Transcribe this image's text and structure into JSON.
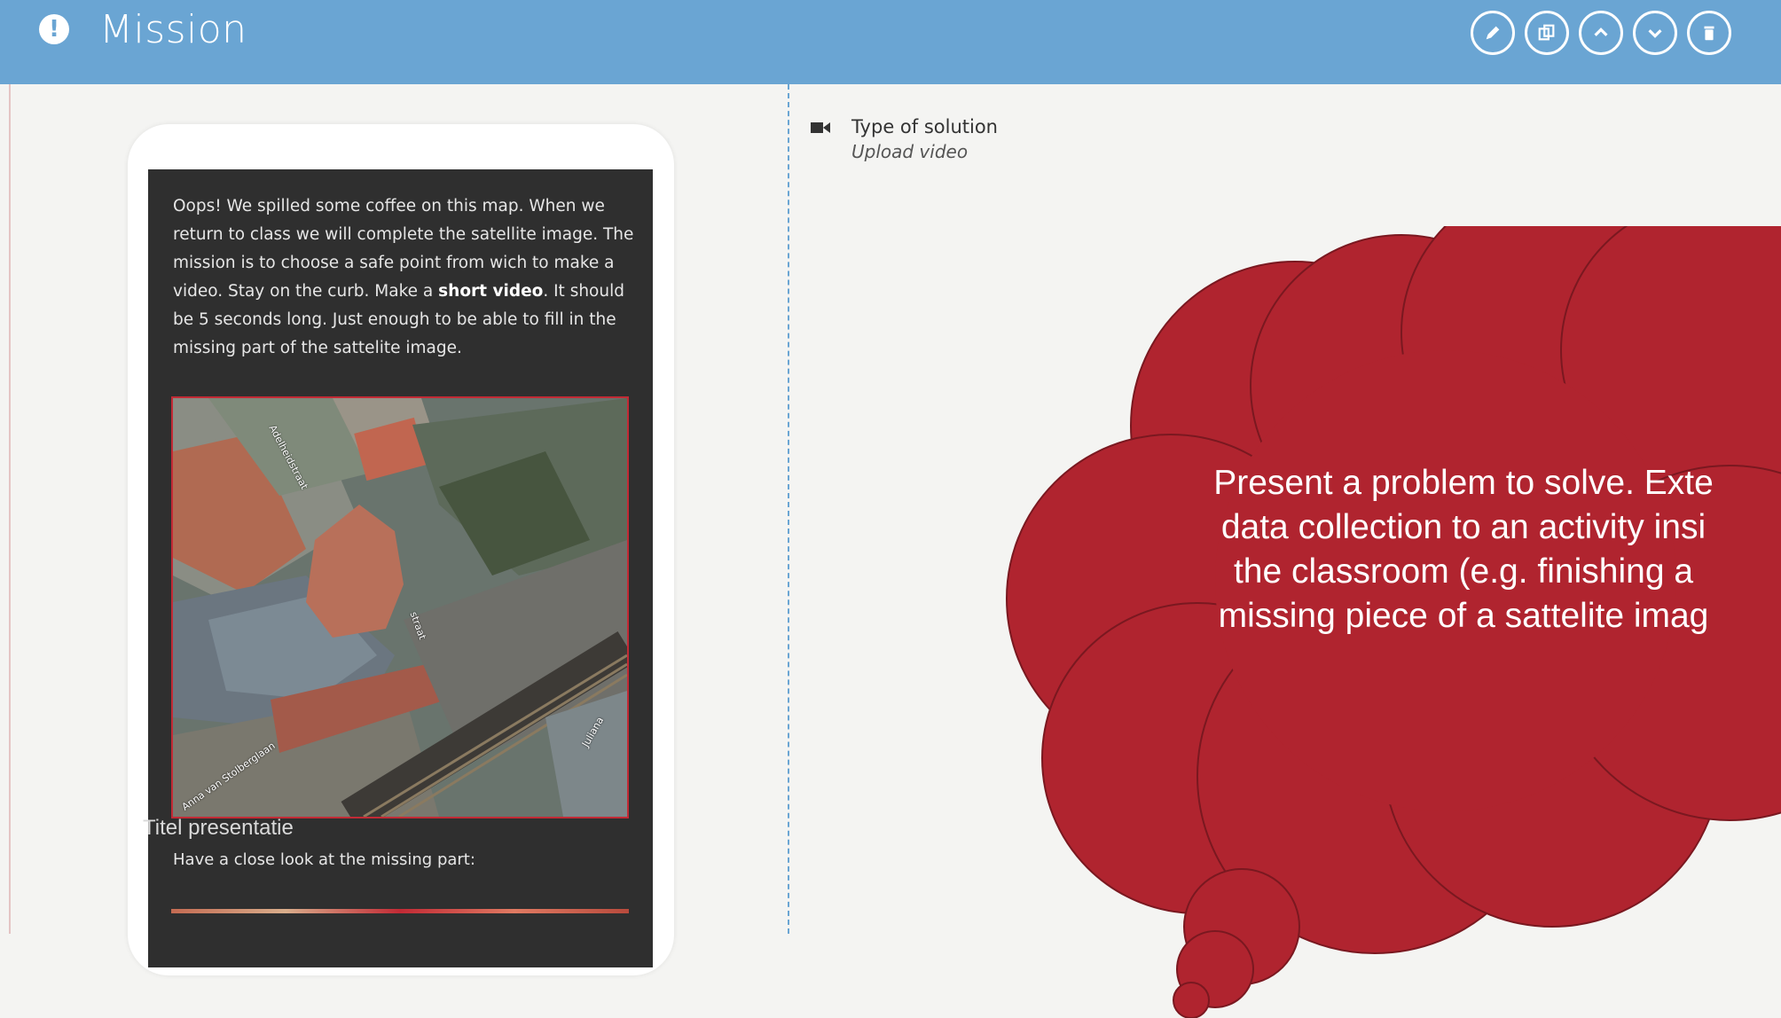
{
  "header": {
    "title": "Mission",
    "alert_icon": "!",
    "actions": [
      {
        "name": "edit-button",
        "icon": "pencil-icon"
      },
      {
        "name": "duplicate-button",
        "icon": "copy-icon"
      },
      {
        "name": "move-up-button",
        "icon": "chevron-up-icon"
      },
      {
        "name": "move-down-button",
        "icon": "chevron-down-icon"
      },
      {
        "name": "delete-button",
        "icon": "trash-icon"
      }
    ],
    "colors": {
      "bar": "#6aa5d3",
      "icon": "#ffffff"
    }
  },
  "mission": {
    "description_parts": [
      "Oops! We spilled some coffee on this map. When we return to class we will complete the satellite image. The mission is to choose a safe point from wich to make a video. Stay on the curb. Make a ",
      "short video",
      ". It should be 5 seconds long. Just enough to be able to fill in the missing part of the sattelite image."
    ],
    "map_labels": [
      "Adelheidstraat",
      "straat",
      "Anna van Stolberglaan",
      "Juliana"
    ],
    "missing_part_label": "Have a close look at the missing part:"
  },
  "solution": {
    "icon": "video-camera-icon",
    "label": "Type of solution",
    "value": "Upload video"
  },
  "callout": {
    "lines": [
      "Present a problem to solve. Exte",
      "data collection to an activity insi",
      "the classroom (e.g. finishing a",
      "missing piece of a sattelite imag"
    ],
    "color": "#b0242f"
  },
  "footer": {
    "presentation_title": "Titel presentatie"
  }
}
